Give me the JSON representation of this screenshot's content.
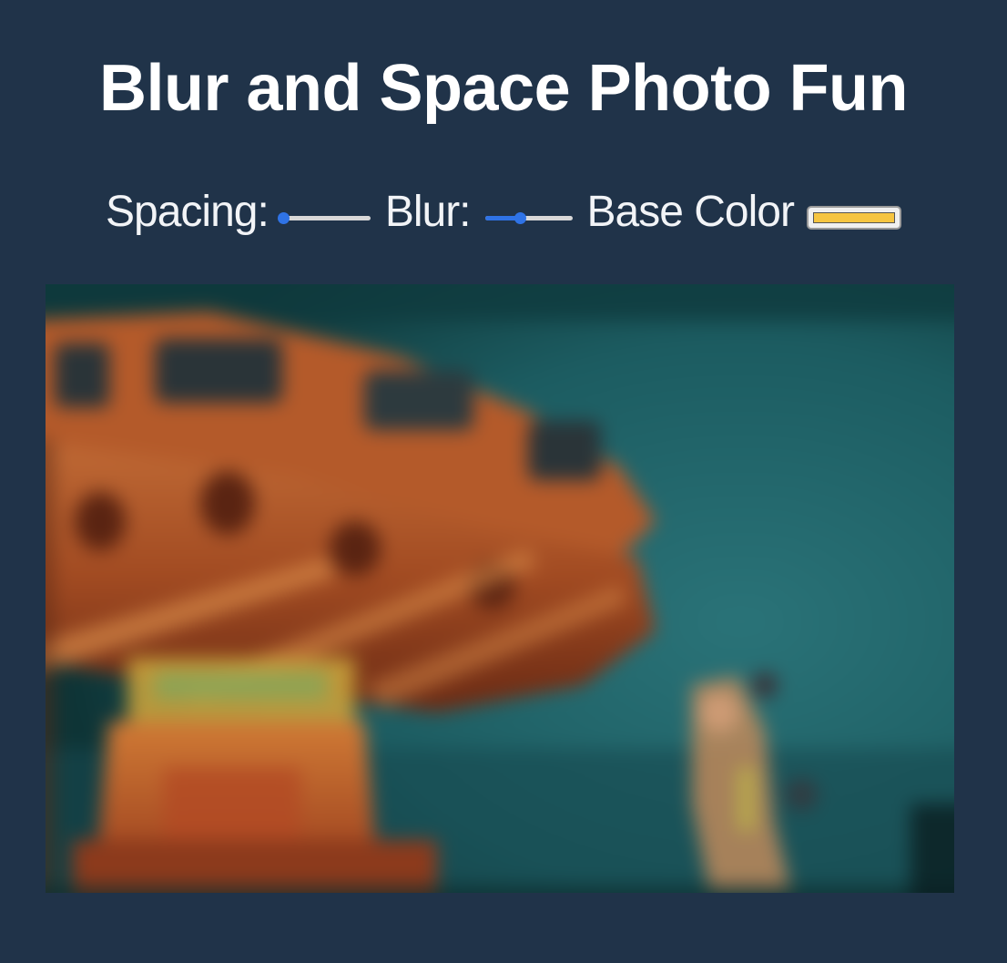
{
  "page": {
    "title": "Blur and Space Photo Fun",
    "background_color": "#203349"
  },
  "controls": {
    "spacing": {
      "label": "Spacing:",
      "value_fraction": 0.0
    },
    "blur": {
      "label": "Blur:",
      "value_fraction": 0.4
    },
    "base_color": {
      "label": "Base Color",
      "value": "#f6c541"
    },
    "accent_color": "#2f73e6"
  },
  "photo": {
    "alt": "Blurred photo of a swing carousel ride against a teal sky"
  }
}
